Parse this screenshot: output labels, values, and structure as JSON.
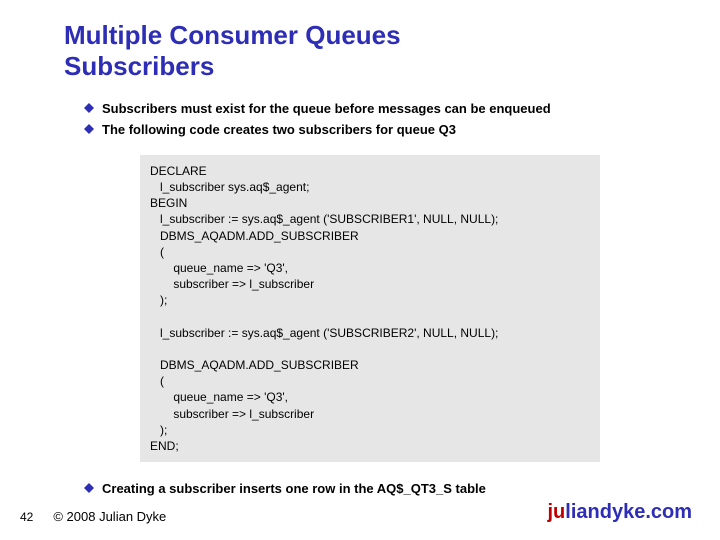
{
  "title_line1": "Multiple Consumer Queues",
  "title_line2": "Subscribers",
  "bullets": {
    "b1": "Subscribers must exist for the queue before messages can be enqueued",
    "b2": "The following code creates two subscribers for queue Q3"
  },
  "code": "DECLARE\n   l_subscriber sys.aq$_agent;\nBEGIN\n   l_subscriber := sys.aq$_agent ('SUBSCRIBER1', NULL, NULL);\n   DBMS_AQADM.ADD_SUBSCRIBER\n   (\n       queue_name => 'Q3',\n       subscriber => l_subscriber\n   );\n\n   l_subscriber := sys.aq$_agent ('SUBSCRIBER2', NULL, NULL);\n\n   DBMS_AQADM.ADD_SUBSCRIBER\n   (\n       queue_name => 'Q3',\n       subscriber => l_subscriber\n   );\nEND;",
  "bottom_bullet": "Creating a subscriber inserts one row in the AQ$_QT3_S table",
  "footer": {
    "page": "42",
    "copyright": "© 2008 Julian Dyke",
    "site_ju": "ju",
    "site_rest": "liandyke.com"
  }
}
